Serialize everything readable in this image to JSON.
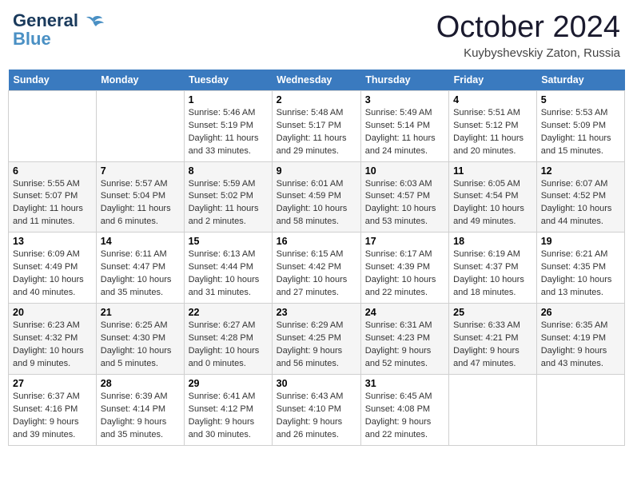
{
  "header": {
    "logo_line1": "General",
    "logo_line2": "Blue",
    "month": "October 2024",
    "location": "Kuybyshevskiy Zaton, Russia"
  },
  "days_of_week": [
    "Sunday",
    "Monday",
    "Tuesday",
    "Wednesday",
    "Thursday",
    "Friday",
    "Saturday"
  ],
  "weeks": [
    [
      {
        "day": "",
        "sunrise": "",
        "sunset": "",
        "daylight": ""
      },
      {
        "day": "",
        "sunrise": "",
        "sunset": "",
        "daylight": ""
      },
      {
        "day": "1",
        "sunrise": "Sunrise: 5:46 AM",
        "sunset": "Sunset: 5:19 PM",
        "daylight": "Daylight: 11 hours and 33 minutes."
      },
      {
        "day": "2",
        "sunrise": "Sunrise: 5:48 AM",
        "sunset": "Sunset: 5:17 PM",
        "daylight": "Daylight: 11 hours and 29 minutes."
      },
      {
        "day": "3",
        "sunrise": "Sunrise: 5:49 AM",
        "sunset": "Sunset: 5:14 PM",
        "daylight": "Daylight: 11 hours and 24 minutes."
      },
      {
        "day": "4",
        "sunrise": "Sunrise: 5:51 AM",
        "sunset": "Sunset: 5:12 PM",
        "daylight": "Daylight: 11 hours and 20 minutes."
      },
      {
        "day": "5",
        "sunrise": "Sunrise: 5:53 AM",
        "sunset": "Sunset: 5:09 PM",
        "daylight": "Daylight: 11 hours and 15 minutes."
      }
    ],
    [
      {
        "day": "6",
        "sunrise": "Sunrise: 5:55 AM",
        "sunset": "Sunset: 5:07 PM",
        "daylight": "Daylight: 11 hours and 11 minutes."
      },
      {
        "day": "7",
        "sunrise": "Sunrise: 5:57 AM",
        "sunset": "Sunset: 5:04 PM",
        "daylight": "Daylight: 11 hours and 6 minutes."
      },
      {
        "day": "8",
        "sunrise": "Sunrise: 5:59 AM",
        "sunset": "Sunset: 5:02 PM",
        "daylight": "Daylight: 11 hours and 2 minutes."
      },
      {
        "day": "9",
        "sunrise": "Sunrise: 6:01 AM",
        "sunset": "Sunset: 4:59 PM",
        "daylight": "Daylight: 10 hours and 58 minutes."
      },
      {
        "day": "10",
        "sunrise": "Sunrise: 6:03 AM",
        "sunset": "Sunset: 4:57 PM",
        "daylight": "Daylight: 10 hours and 53 minutes."
      },
      {
        "day": "11",
        "sunrise": "Sunrise: 6:05 AM",
        "sunset": "Sunset: 4:54 PM",
        "daylight": "Daylight: 10 hours and 49 minutes."
      },
      {
        "day": "12",
        "sunrise": "Sunrise: 6:07 AM",
        "sunset": "Sunset: 4:52 PM",
        "daylight": "Daylight: 10 hours and 44 minutes."
      }
    ],
    [
      {
        "day": "13",
        "sunrise": "Sunrise: 6:09 AM",
        "sunset": "Sunset: 4:49 PM",
        "daylight": "Daylight: 10 hours and 40 minutes."
      },
      {
        "day": "14",
        "sunrise": "Sunrise: 6:11 AM",
        "sunset": "Sunset: 4:47 PM",
        "daylight": "Daylight: 10 hours and 35 minutes."
      },
      {
        "day": "15",
        "sunrise": "Sunrise: 6:13 AM",
        "sunset": "Sunset: 4:44 PM",
        "daylight": "Daylight: 10 hours and 31 minutes."
      },
      {
        "day": "16",
        "sunrise": "Sunrise: 6:15 AM",
        "sunset": "Sunset: 4:42 PM",
        "daylight": "Daylight: 10 hours and 27 minutes."
      },
      {
        "day": "17",
        "sunrise": "Sunrise: 6:17 AM",
        "sunset": "Sunset: 4:39 PM",
        "daylight": "Daylight: 10 hours and 22 minutes."
      },
      {
        "day": "18",
        "sunrise": "Sunrise: 6:19 AM",
        "sunset": "Sunset: 4:37 PM",
        "daylight": "Daylight: 10 hours and 18 minutes."
      },
      {
        "day": "19",
        "sunrise": "Sunrise: 6:21 AM",
        "sunset": "Sunset: 4:35 PM",
        "daylight": "Daylight: 10 hours and 13 minutes."
      }
    ],
    [
      {
        "day": "20",
        "sunrise": "Sunrise: 6:23 AM",
        "sunset": "Sunset: 4:32 PM",
        "daylight": "Daylight: 10 hours and 9 minutes."
      },
      {
        "day": "21",
        "sunrise": "Sunrise: 6:25 AM",
        "sunset": "Sunset: 4:30 PM",
        "daylight": "Daylight: 10 hours and 5 minutes."
      },
      {
        "day": "22",
        "sunrise": "Sunrise: 6:27 AM",
        "sunset": "Sunset: 4:28 PM",
        "daylight": "Daylight: 10 hours and 0 minutes."
      },
      {
        "day": "23",
        "sunrise": "Sunrise: 6:29 AM",
        "sunset": "Sunset: 4:25 PM",
        "daylight": "Daylight: 9 hours and 56 minutes."
      },
      {
        "day": "24",
        "sunrise": "Sunrise: 6:31 AM",
        "sunset": "Sunset: 4:23 PM",
        "daylight": "Daylight: 9 hours and 52 minutes."
      },
      {
        "day": "25",
        "sunrise": "Sunrise: 6:33 AM",
        "sunset": "Sunset: 4:21 PM",
        "daylight": "Daylight: 9 hours and 47 minutes."
      },
      {
        "day": "26",
        "sunrise": "Sunrise: 6:35 AM",
        "sunset": "Sunset: 4:19 PM",
        "daylight": "Daylight: 9 hours and 43 minutes."
      }
    ],
    [
      {
        "day": "27",
        "sunrise": "Sunrise: 6:37 AM",
        "sunset": "Sunset: 4:16 PM",
        "daylight": "Daylight: 9 hours and 39 minutes."
      },
      {
        "day": "28",
        "sunrise": "Sunrise: 6:39 AM",
        "sunset": "Sunset: 4:14 PM",
        "daylight": "Daylight: 9 hours and 35 minutes."
      },
      {
        "day": "29",
        "sunrise": "Sunrise: 6:41 AM",
        "sunset": "Sunset: 4:12 PM",
        "daylight": "Daylight: 9 hours and 30 minutes."
      },
      {
        "day": "30",
        "sunrise": "Sunrise: 6:43 AM",
        "sunset": "Sunset: 4:10 PM",
        "daylight": "Daylight: 9 hours and 26 minutes."
      },
      {
        "day": "31",
        "sunrise": "Sunrise: 6:45 AM",
        "sunset": "Sunset: 4:08 PM",
        "daylight": "Daylight: 9 hours and 22 minutes."
      },
      {
        "day": "",
        "sunrise": "",
        "sunset": "",
        "daylight": ""
      },
      {
        "day": "",
        "sunrise": "",
        "sunset": "",
        "daylight": ""
      }
    ]
  ]
}
